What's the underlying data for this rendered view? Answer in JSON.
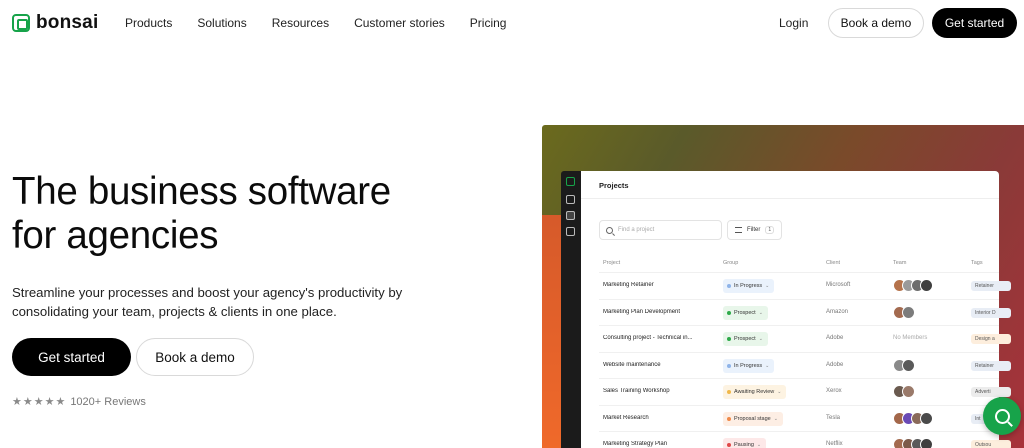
{
  "brand": {
    "name": "bonsai",
    "color": "#17a34a"
  },
  "nav": {
    "links": [
      "Products",
      "Solutions",
      "Resources",
      "Customer stories",
      "Pricing"
    ],
    "login": "Login",
    "book_demo": "Book a demo",
    "get_started": "Get started"
  },
  "hero": {
    "title_line1": "The business software",
    "title_line2": "for agencies",
    "subtitle": "Streamline your processes and boost your agency's productivity by consolidating your team, projects & clients in one place.",
    "get_started": "Get started",
    "book_demo": "Book a demo",
    "stars": "★★★★★",
    "rating": 5,
    "reviews": "1020+ Reviews"
  },
  "app_preview": {
    "title": "Projects",
    "search_placeholder": "Find a project",
    "filter_label": "Filter",
    "filter_count": "1",
    "columns": [
      "Project",
      "Group",
      "Client",
      "Team",
      "Tags"
    ],
    "rows": [
      {
        "project": "Marketing Retainer",
        "group": "In Progress",
        "group_color": "#8fb4e8",
        "group_bg": "#eaf2fc",
        "client": "Microsoft",
        "team": [
          "#b5734b",
          "#9a9a9a",
          "#6d6d6d",
          "#3f3f3f"
        ],
        "tag": "Retainer",
        "tag_bg": "#e8edf5"
      },
      {
        "project": "Marketing Plan Development",
        "group": "Prospect",
        "group_color": "#2eaa4a",
        "group_bg": "#e8f6ea",
        "client": "Amazon",
        "team": [
          "#a36a4f",
          "#7c7c7c"
        ],
        "tag": "Interior D",
        "tag_bg": "#e8edf5"
      },
      {
        "project": "Consulting project - Technical in...",
        "group": "Prospect",
        "group_color": "#2eaa4a",
        "group_bg": "#e8f6ea",
        "client": "Adobe",
        "team": [],
        "team_empty": "No Members",
        "tag": "Design a",
        "tag_bg": "#fdeedd"
      },
      {
        "project": "Website maintenance",
        "group": "In Progress",
        "group_color": "#8fb4e8",
        "group_bg": "#eaf2fc",
        "client": "Adobe",
        "team": [
          "#8a8a8a",
          "#5a5a5a"
        ],
        "tag": "Retainer",
        "tag_bg": "#e8edf5"
      },
      {
        "project": "Sales Training Workshop",
        "group": "Awaiting Review",
        "group_color": "#f0b84a",
        "group_bg": "#fdf3e2",
        "client": "Xerox",
        "team": [
          "#6a5a4f",
          "#9a7a6a"
        ],
        "tag": "Adverti",
        "tag_bg": "#ececec"
      },
      {
        "project": "Market Research",
        "group": "Proposal stage",
        "group_color": "#f08a4a",
        "group_bg": "#fdeee4",
        "client": "Tesla",
        "team": [
          "#a3674a",
          "#6a4ab5",
          "#8a6a5a",
          "#4a4a4a"
        ],
        "tag": "Int",
        "tag_bg": "#e8edf5"
      },
      {
        "project": "Marketing Strategy Plan",
        "group": "Pausing",
        "group_color": "#e04a4a",
        "group_bg": "#fde8e8",
        "client": "Netflix",
        "team": [
          "#a36a4f",
          "#7c5a4a",
          "#5a5a5a",
          "#3f3f3f"
        ],
        "tag": "Outsou",
        "tag_bg": "#fdeedd"
      }
    ]
  },
  "help_button": {
    "icon": "search-chat-icon"
  }
}
